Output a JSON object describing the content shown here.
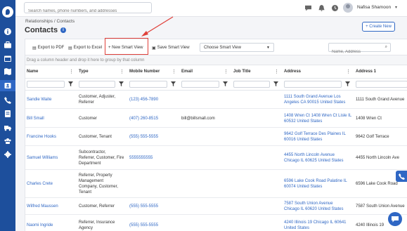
{
  "topbar": {
    "search_placeholder": "Search names, phone numbers, and addresses",
    "user_name": "Nafisa Shamoon"
  },
  "page": {
    "breadcrumb": "Relationships / Contacts",
    "title": "Contacts",
    "create_button": "+ Create New"
  },
  "toolbar": {
    "export_pdf": "Export to PDF",
    "export_excel": "Export to Excel",
    "new_smart_view": "+ New Smart View",
    "save_smart_view": "Save Smart View",
    "smart_view_select": "Choose Smart View",
    "search_placeholder": "Name, Address"
  },
  "group_bar_text": "Drag a column header and drop it here to group by that column",
  "columns": [
    "Name",
    "Type",
    "Mobile Number",
    "Email",
    "Job Title",
    "Address",
    "Address 1"
  ],
  "rows": [
    {
      "name": "Sandie Waite",
      "type": [
        "Customer, Adjuster,",
        "Referrer"
      ],
      "mobile": "(123) 456-7890",
      "email": "",
      "job": "",
      "address": [
        "1111 South Grand Avenue Los",
        "Angeles CA 90015 United States"
      ],
      "address1": "1111 South Grand Avenue"
    },
    {
      "name": "Bill Small",
      "type": [
        "Customer"
      ],
      "mobile": "(407) 260-8515",
      "email": "bill@billsmall.com",
      "job": "",
      "address": [
        "1408 Wren Ct 1408 Wren Ct Lisle IL",
        "60532 United States"
      ],
      "address1": "1408 Wren Ct"
    },
    {
      "name": "Francine Hooks",
      "type": [
        "Customer, Tenant"
      ],
      "mobile": "(555) 555-5555",
      "email": "",
      "job": "",
      "address": [
        "9642 Golf Terrace Des Plaines IL",
        "60016 United States"
      ],
      "address1": "9642 Golf Terrace"
    },
    {
      "name": "Samuel Williams",
      "type": [
        "Subcontractor,",
        "Referrer, Customer, Fire",
        "Department"
      ],
      "mobile": "5555555555",
      "email": "",
      "job": "",
      "address": [
        "4455 North Lincoln Avenue",
        "Chicago IL 60625 United States"
      ],
      "address1": "4455 North Lincoln Ave"
    },
    {
      "name": "Charles Crete",
      "type": [
        "Referrer, Property",
        "Management",
        "Company, Customer,",
        "Tenant"
      ],
      "mobile": "",
      "email": "",
      "job": "",
      "address": [
        "6596 Lake Cook Road Palatine IL",
        "60074 United States"
      ],
      "address1": "6596 Lake Cook Road"
    },
    {
      "name": "Wilfred Maussen",
      "type": [
        "Customer, Referrer"
      ],
      "mobile": "(555) 555-5555",
      "email": "",
      "job": "",
      "address": [
        "7587 South Union Avenue",
        "Chicago IL 60620 United States"
      ],
      "address1": "7587 South Union Avenue"
    },
    {
      "name": "Naomi Ingride",
      "type": [
        "Referrer, Insurance",
        "Agency"
      ],
      "mobile": "(555) 555-5555",
      "email": "",
      "job": "",
      "address": [
        "4240 Illinois 19 Chicago IL 60641",
        "United States"
      ],
      "address1": "4240 Illinois 19"
    }
  ],
  "icons": {
    "sidebar": [
      "logo",
      "info-icon",
      "briefcase-icon",
      "calendar-icon",
      "map-icon",
      "contacts-icon",
      "phone-icon",
      "document-icon",
      "truck-icon",
      "users-icon",
      "gear-icon"
    ],
    "topbar": [
      "chat-icon",
      "bell-icon",
      "clock-icon",
      "avatar"
    ]
  },
  "colors": {
    "sidebar": "#1d4f9c",
    "accent": "#2f67c4",
    "highlight": "#e0403a"
  }
}
